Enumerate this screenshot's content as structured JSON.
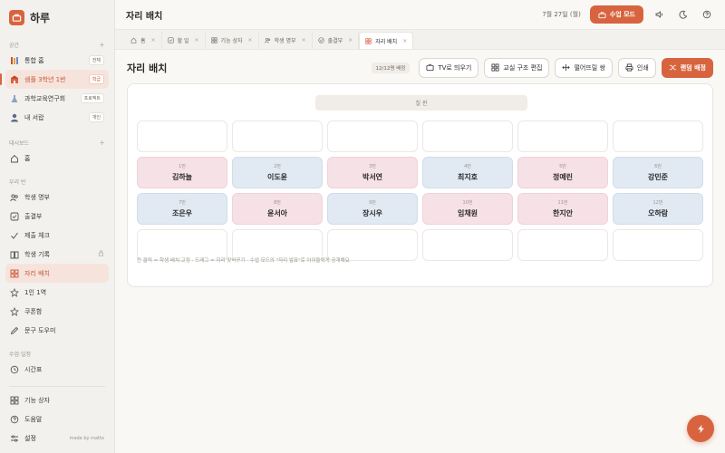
{
  "app": {
    "name": "하루"
  },
  "sidebar": {
    "sections": {
      "space": "공간",
      "dashboard": "대시보드",
      "our_class": "우리 반",
      "lessons": "수업·일정"
    },
    "space_items": [
      {
        "label": "통합 홈",
        "badge": "전체",
        "icon": "bookshelf-icon"
      },
      {
        "label": "샘플 3학년 1반",
        "badge": "학급",
        "icon": "school-icon",
        "active": true
      },
      {
        "label": "과학교육연구회",
        "badge": "프로젝트",
        "icon": "flask-icon"
      },
      {
        "label": "내 서랍",
        "badge": "개인",
        "icon": "person-icon"
      }
    ],
    "dashboard_items": [
      {
        "label": "홈",
        "icon": "home-icon"
      }
    ],
    "class_items": [
      {
        "label": "학생 명부",
        "icon": "users-icon"
      },
      {
        "label": "출결부",
        "icon": "checkbox-icon"
      },
      {
        "label": "제출 체크",
        "icon": "check-icon"
      },
      {
        "label": "학생 기록",
        "icon": "book-icon",
        "locked": true
      },
      {
        "label": "자리 배치",
        "icon": "grid-icon",
        "active": true
      },
      {
        "label": "1인 1역",
        "icon": "star-icon"
      },
      {
        "label": "쿠폰함",
        "icon": "star-icon"
      },
      {
        "label": "문구 도우미",
        "icon": "pencil-icon"
      }
    ],
    "lesson_items": [
      {
        "label": "시간표",
        "icon": "clock-icon"
      }
    ],
    "bottom_items": [
      {
        "label": "기능 상자",
        "icon": "grid-icon"
      },
      {
        "label": "도움말",
        "icon": "help-icon"
      },
      {
        "label": "설정",
        "icon": "sliders-icon"
      }
    ],
    "made_by": "made by matto"
  },
  "topbar": {
    "title": "자리 배치",
    "date": "7월 27일 (월)",
    "class_mode_label": "수업 모드"
  },
  "tabs": [
    {
      "label": "홈",
      "icon": "home-icon"
    },
    {
      "label": "할 일",
      "icon": "checkbox-icon"
    },
    {
      "label": "기능 상자",
      "icon": "grid-icon"
    },
    {
      "label": "학생 명부",
      "icon": "users-icon"
    },
    {
      "label": "출결부",
      "icon": "check-circle-icon"
    },
    {
      "label": "자리 배치",
      "icon": "grid-icon",
      "active": true
    }
  ],
  "page": {
    "title": "자리 배치",
    "count": "12/12명 배정",
    "buttons": {
      "tv": "TV로 띄우기",
      "structure": "교실 구조 편집",
      "apart": "떨어뜨릴 쌍",
      "print": "인쇄",
      "random": "랜덤 배정"
    },
    "blackboard": "칠 판",
    "hint": "칸 클릭 = 학생 배치·고정 · 드래그 = 자리 맞바꾸기 · 수업 모드의 \"자리 발표\"로 아이들에게 공개해요"
  },
  "seats": [
    {
      "num": "",
      "name": "",
      "color": "empty"
    },
    {
      "num": "",
      "name": "",
      "color": "empty"
    },
    {
      "num": "",
      "name": "",
      "color": "empty"
    },
    {
      "num": "",
      "name": "",
      "color": "empty"
    },
    {
      "num": "",
      "name": "",
      "color": "empty"
    },
    {
      "num": "",
      "name": "",
      "color": "empty"
    },
    {
      "num": "1번",
      "name": "김하늘",
      "color": "pink"
    },
    {
      "num": "2번",
      "name": "이도윤",
      "color": "blue"
    },
    {
      "num": "3번",
      "name": "박서연",
      "color": "pink"
    },
    {
      "num": "4번",
      "name": "최지호",
      "color": "blue"
    },
    {
      "num": "5번",
      "name": "정예린",
      "color": "pink"
    },
    {
      "num": "6번",
      "name": "강민준",
      "color": "blue"
    },
    {
      "num": "7번",
      "name": "조은우",
      "color": "blue"
    },
    {
      "num": "8번",
      "name": "윤서아",
      "color": "pink"
    },
    {
      "num": "9번",
      "name": "장시우",
      "color": "blue"
    },
    {
      "num": "10번",
      "name": "임채원",
      "color": "pink"
    },
    {
      "num": "11번",
      "name": "한지안",
      "color": "pink"
    },
    {
      "num": "12번",
      "name": "오하람",
      "color": "blue"
    },
    {
      "num": "",
      "name": "",
      "color": "empty"
    },
    {
      "num": "",
      "name": "",
      "color": "empty"
    },
    {
      "num": "",
      "name": "",
      "color": "empty"
    },
    {
      "num": "",
      "name": "",
      "color": "empty"
    },
    {
      "num": "",
      "name": "",
      "color": "empty"
    },
    {
      "num": "",
      "name": "",
      "color": "empty"
    }
  ],
  "colors": {
    "accent": "#d8643f",
    "pink_seat": "#f6e1e6",
    "blue_seat": "#e1e9f3"
  }
}
